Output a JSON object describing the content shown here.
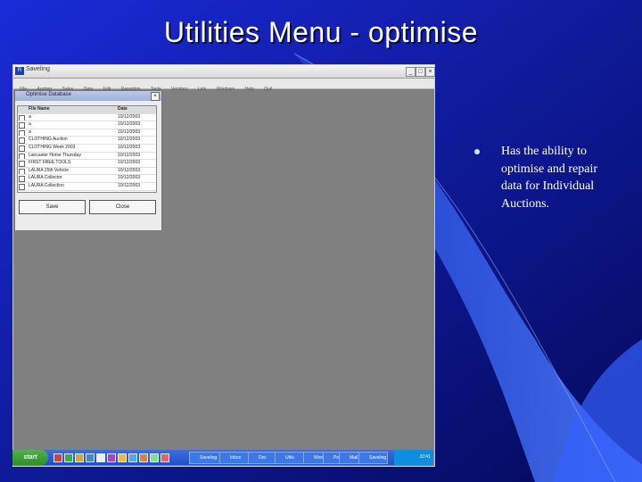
{
  "slide": {
    "title": "Utilities Menu - optimise",
    "bullet": "Has the ability to optimise and repair data for Individual Auctions."
  },
  "app": {
    "title": "Saveling",
    "menu": [
      "File",
      "Auction",
      "Sales",
      "Data",
      "Edit",
      "Reporting",
      "Tools",
      "Vendors",
      "Lots",
      "Windows",
      "Help",
      "Quit"
    ]
  },
  "dialog": {
    "title": "Optimise Database",
    "columns": [
      "File Name",
      "Date"
    ],
    "rows": [
      [
        "a",
        "10/12/2003"
      ],
      [
        "a",
        "10/12/2003"
      ],
      [
        "a",
        "10/12/2003"
      ],
      [
        "CLOTHING Auction",
        "10/12/2003"
      ],
      [
        "CLOTHING Week 2003",
        "10/12/2003"
      ],
      [
        "Lancaster Horse Thursday",
        "10/12/2003"
      ],
      [
        "FIRST FREE TOOLS",
        "10/12/2003"
      ],
      [
        "LAURA 25th Vehicle",
        "10/12/2003"
      ],
      [
        "LAURA Collector",
        "10/12/2003"
      ],
      [
        "LAURA Collection",
        "10/12/2003"
      ]
    ],
    "ok_label": "Save",
    "cancel_label": "Close"
  },
  "taskbar": {
    "start_label": "start",
    "tasks": [
      "Saveling",
      "Inbox",
      "Doc",
      "Utils",
      "Word",
      "Prev",
      "Mail",
      "Saveling"
    ],
    "clock": "10:41"
  }
}
